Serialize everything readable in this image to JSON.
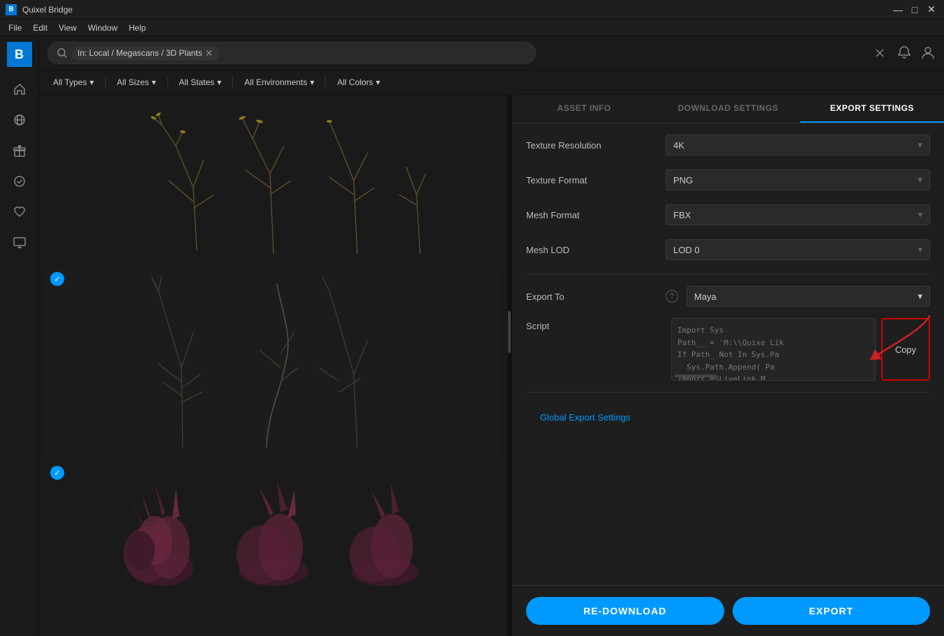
{
  "titlebar": {
    "title": "Quixel Bridge",
    "close_label": "✕",
    "minimize_label": "—",
    "maximize_label": "□"
  },
  "menubar": {
    "items": [
      "File",
      "Edit",
      "View",
      "Window",
      "Help"
    ]
  },
  "search": {
    "placeholder": "",
    "tag": "In: Local / Megascans / 3D Plants",
    "close_icon": "✕"
  },
  "filters": {
    "types": "All Types",
    "sizes": "All Sizes",
    "states": "All States",
    "environments": "All Environments",
    "colors": "All Colors",
    "arrow": "▾"
  },
  "panel": {
    "tabs": [
      "ASSET INFO",
      "DOWNLOAD SETTINGS",
      "EXPORT SETTINGS"
    ],
    "active_tab": 2,
    "settings": {
      "texture_resolution": {
        "label": "Texture Resolution",
        "value": "4K"
      },
      "texture_format": {
        "label": "Texture Format",
        "value": "PNG"
      },
      "mesh_format": {
        "label": "Mesh Format",
        "value": "FBX"
      },
      "mesh_lod": {
        "label": "Mesh LOD",
        "value": "LOD 0"
      }
    },
    "export_to": {
      "label": "Export To",
      "value": "Maya",
      "help": "?"
    },
    "script": {
      "label": "Script",
      "code": "Import Sys\nPath__ = 'M:\\\\Quixe Lik\nIf Path_ Not In Sys.Pa\n  Sys.Path.Append( Pa\nImport MSLiveLink.M\nMsAPI.CreateMSshe",
      "copy_label": "Copy"
    },
    "global_settings": "Global Export Settings",
    "redownload_label": "RE-DOWNLOAD",
    "export_label": "EXPORT"
  },
  "sidebar": {
    "items": [
      {
        "icon": "⌂",
        "name": "home-icon"
      },
      {
        "icon": "🌐",
        "name": "globe-icon"
      },
      {
        "icon": "🎁",
        "name": "gift-icon"
      },
      {
        "icon": "✓",
        "name": "check-icon"
      },
      {
        "icon": "♡",
        "name": "heart-icon"
      },
      {
        "icon": "🖥",
        "name": "monitor-icon"
      }
    ]
  },
  "colors": {
    "accent": "#0099ff",
    "background": "#1a1a1a",
    "panel_bg": "#1e1e1e",
    "copy_border": "#cc0000"
  }
}
